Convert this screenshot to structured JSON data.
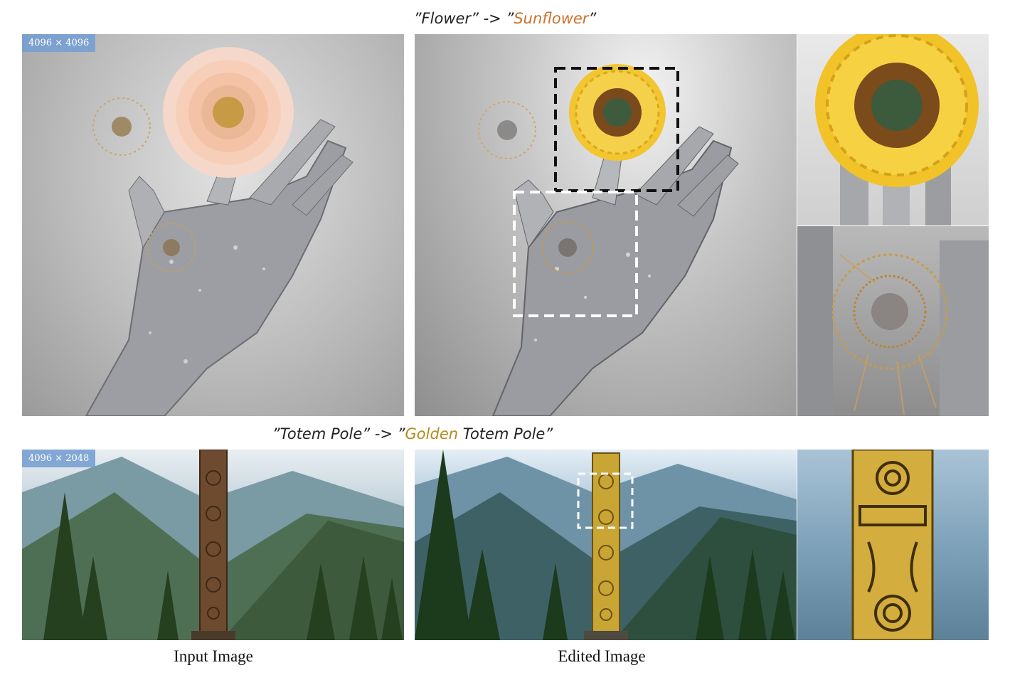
{
  "captions": {
    "top": {
      "prefix": "”Flower” -> ”",
      "highlight": "Sunflower",
      "suffix": "”"
    },
    "mid": {
      "prefix": "”Totem Pole” -> ”",
      "highlight": "Golden",
      "suffix": " Totem Pole”"
    }
  },
  "badges": {
    "row1": "4096 × 4096",
    "row2": "4096 × 2048"
  },
  "labels": {
    "input": "Input Image",
    "edited": "Edited Image"
  },
  "colors": {
    "sunflower_highlight": "#c8722e",
    "golden_highlight": "#b58a1c",
    "badge": "#78a0d2"
  }
}
